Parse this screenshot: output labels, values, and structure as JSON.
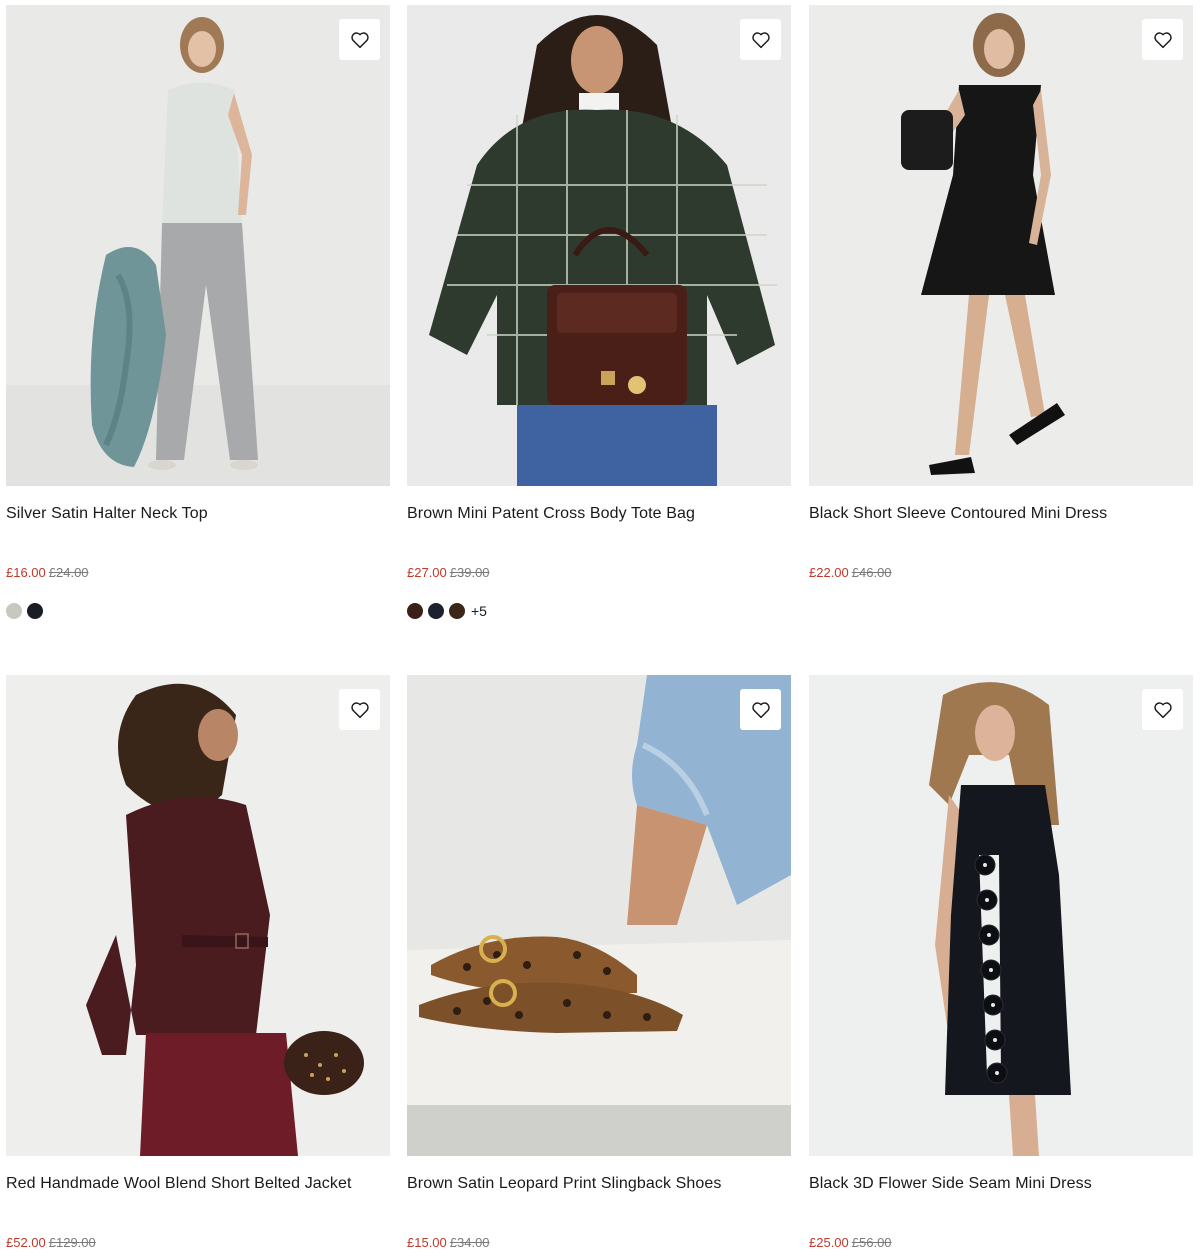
{
  "products": [
    {
      "name": "Silver Satin Halter Neck Top",
      "price": "£16.00",
      "was_price": "£24.00",
      "swatches": [
        "#c7c8c0",
        "#1b1d24"
      ],
      "more_colors": ""
    },
    {
      "name": "Brown Mini Patent Cross Body Tote Bag",
      "price": "£27.00",
      "was_price": "£39.00",
      "swatches": [
        "#3a2016",
        "#1e2130",
        "#3b2618"
      ],
      "more_colors": "+5"
    },
    {
      "name": "Black Short Sleeve Contoured Mini Dress",
      "price": "£22.00",
      "was_price": "£46.00",
      "swatches": [],
      "more_colors": ""
    },
    {
      "name": "Red Handmade Wool Blend Short Belted Jacket",
      "price": "£52.00",
      "was_price": "£129.00",
      "swatches": [],
      "more_colors": ""
    },
    {
      "name": "Brown Satin Leopard Print Slingback Shoes",
      "price": "£15.00",
      "was_price": "£34.00",
      "swatches": [],
      "more_colors": ""
    },
    {
      "name": "Black 3D Flower Side Seam Mini Dress",
      "price": "£25.00",
      "was_price": "£56.00",
      "swatches": [],
      "more_colors": ""
    }
  ],
  "icons": {
    "wishlist": "heart-outline-icon"
  },
  "colors": {
    "sale_price": "#c0392b",
    "was_price": "#7a7a7a"
  }
}
